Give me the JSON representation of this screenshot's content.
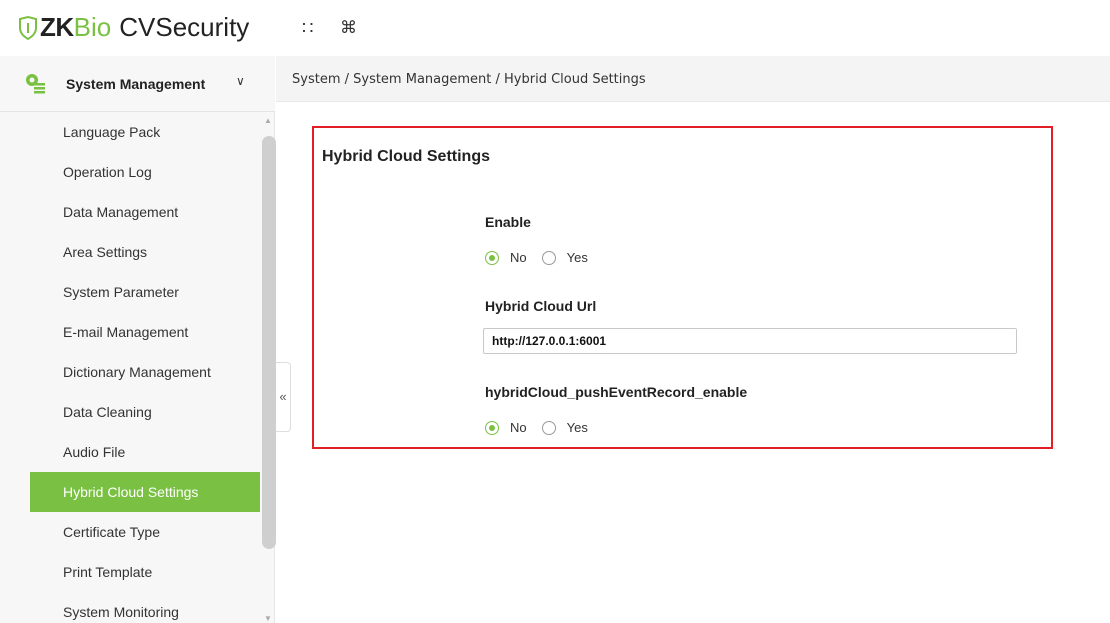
{
  "brand": {
    "zk": "ZK",
    "bio": "Bio",
    "product": "CVSecurity",
    "accent_color": "#7ac143"
  },
  "topbar": {
    "icons": [
      "apps-grid-icon",
      "command-icon"
    ],
    "apps_glyph": "∷",
    "command_glyph": "⌘"
  },
  "sidebar": {
    "module_title": "System Management",
    "module_chevron": "∨",
    "collapse_glyph": "«",
    "items": [
      {
        "label": "Language Pack",
        "active": false
      },
      {
        "label": "Operation Log",
        "active": false
      },
      {
        "label": "Data Management",
        "active": false
      },
      {
        "label": "Area Settings",
        "active": false
      },
      {
        "label": "System Parameter",
        "active": false
      },
      {
        "label": "E-mail Management",
        "active": false
      },
      {
        "label": "Dictionary Management",
        "active": false
      },
      {
        "label": "Data Cleaning",
        "active": false
      },
      {
        "label": "Audio File",
        "active": false
      },
      {
        "label": "Hybrid Cloud Settings",
        "active": true
      },
      {
        "label": "Certificate Type",
        "active": false
      },
      {
        "label": "Print Template",
        "active": false
      },
      {
        "label": "System Monitoring",
        "active": false
      }
    ]
  },
  "breadcrumb": "System / System Management / Hybrid Cloud Settings",
  "panel": {
    "title": "Hybrid Cloud Settings",
    "highlight_color": "#e31e24",
    "enable": {
      "label": "Enable",
      "options": [
        "No",
        "Yes"
      ],
      "selected": "No"
    },
    "url": {
      "label": "Hybrid Cloud Url",
      "value": "http://127.0.0.1:6001"
    },
    "push_event": {
      "label": "hybridCloud_pushEventRecord_enable",
      "options": [
        "No",
        "Yes"
      ],
      "selected": "No"
    }
  }
}
